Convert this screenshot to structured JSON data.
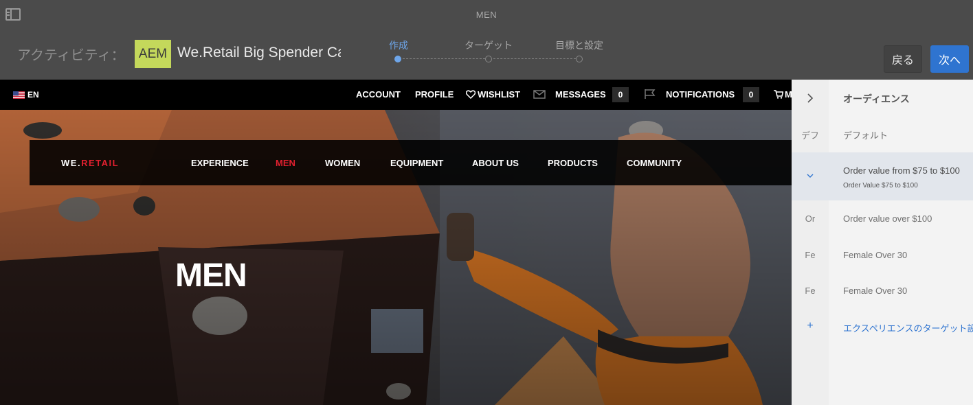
{
  "toolbar": {
    "page_name": "MEN",
    "activity_label": "アクティビティ：",
    "badge": "AEM",
    "activity_title": "We.Retail Big Spender Campaign",
    "back_label": "戻る",
    "next_label": "次へ",
    "accent_color": "#2f74d0"
  },
  "wizard": {
    "steps": [
      {
        "label": "作成",
        "active": true
      },
      {
        "label": "ターゲット",
        "active": false
      },
      {
        "label": "目標と設定",
        "active": false
      }
    ]
  },
  "site": {
    "lang": "EN",
    "top_nav": {
      "account": "ACCOUNT",
      "profile": "PROFILE",
      "wishlist": "WISHLIST",
      "messages": "MESSAGES",
      "messages_count": "0",
      "notifications": "NOTIFICATIONS",
      "notifications_count": "0",
      "cart": "M"
    },
    "logo_prefix": "WE.",
    "logo_suffix": "RETAIL",
    "main_nav": [
      "EXPERIENCE",
      "MEN",
      "WOMEN",
      "EQUIPMENT",
      "ABOUT US",
      "PRODUCTS",
      "COMMUNITY"
    ],
    "main_nav_active": "MEN",
    "hero_title": "MEN",
    "brand_red": "#e0202f"
  },
  "side_panel": {
    "header": "オーディエンス",
    "items": [
      {
        "abbr": "デフ",
        "label": "デフォルト"
      },
      {
        "abbr": "",
        "label": "Order value from $75 to $100",
        "sub": "Order Value $75 to $100",
        "selected": true
      },
      {
        "abbr": "Or",
        "label": "Order value over $100"
      },
      {
        "abbr": "Fe",
        "label": "Female Over 30"
      },
      {
        "abbr": "Fe",
        "label": "Female Over 30"
      }
    ],
    "add_label": "エクスペリエンスのターゲット設定を追加"
  }
}
